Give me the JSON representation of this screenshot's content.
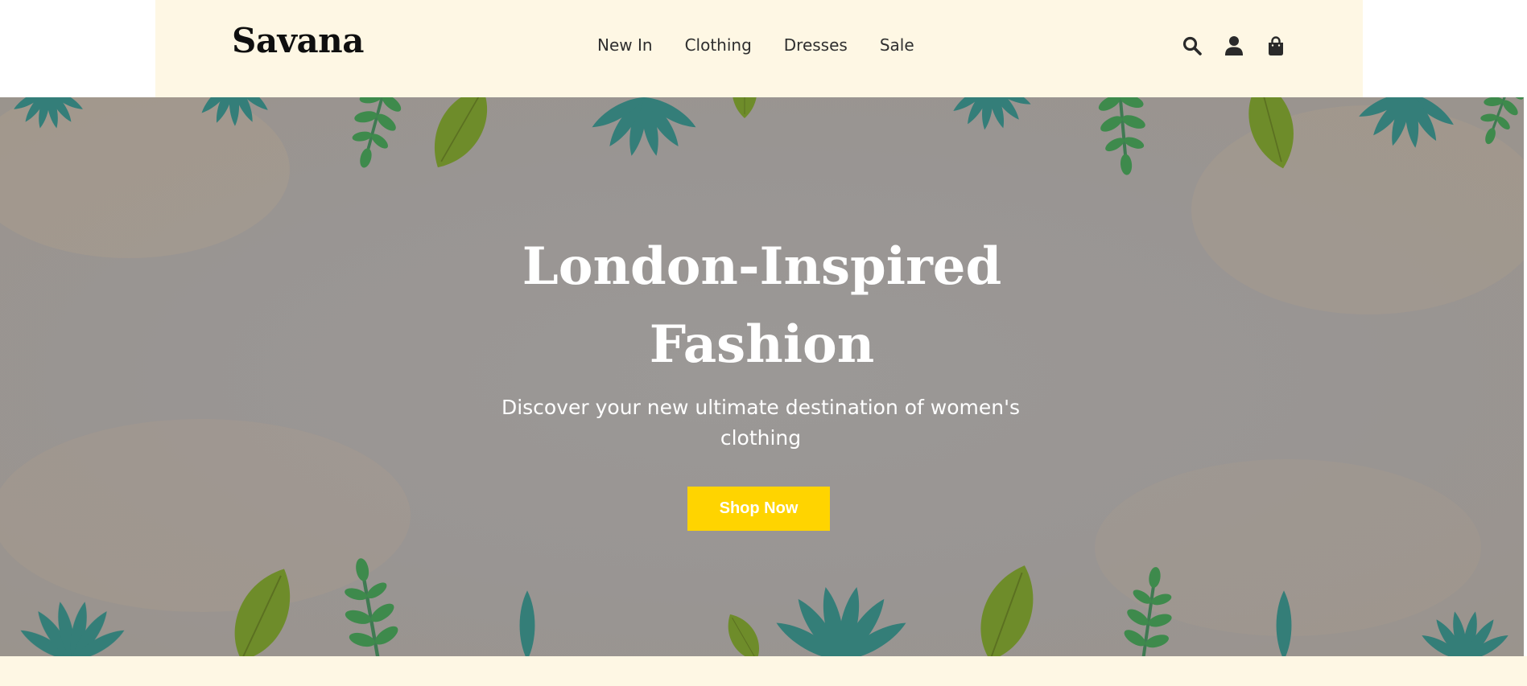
{
  "header": {
    "logo": "Savana",
    "nav": [
      "New In",
      "Clothing",
      "Dresses",
      "Sale"
    ],
    "icons": [
      "search-icon",
      "user-icon",
      "shopping-bag-icon"
    ]
  },
  "hero": {
    "title_line1": "London-Inspired",
    "title_line2": "Fashion",
    "subtitle": "Discover your new ultimate destination of women's clothing",
    "cta_label": "Shop Now"
  },
  "colors": {
    "header_bg": "#fef7e4",
    "cta_bg": "#ffd400",
    "hero_overlay": "#999593",
    "text_dark": "#2f2f2f"
  }
}
